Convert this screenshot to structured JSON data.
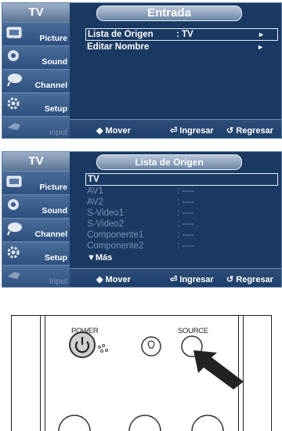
{
  "screen1": {
    "sidebar_title": "TV",
    "header_title": "Entrada",
    "sidebar": [
      {
        "label": "Picture",
        "icon": "picture-icon"
      },
      {
        "label": "Sound",
        "icon": "sound-icon"
      },
      {
        "label": "Channel",
        "icon": "channel-icon"
      },
      {
        "label": "Setup",
        "icon": "setup-icon"
      },
      {
        "label": "Input",
        "icon": "input-icon"
      }
    ],
    "rows": [
      {
        "label": "Lista de Origen",
        "value": ": TV",
        "arrow": "►"
      },
      {
        "label": "Editar Nombre",
        "value": "",
        "arrow": "►"
      }
    ],
    "hints": {
      "move": "◆ Mover",
      "enter": "⏎ Ingresar",
      "return": "↺ Regresar"
    }
  },
  "screen2": {
    "sidebar_title": "TV",
    "header_title": "Lista de Origen",
    "sidebar": [
      {
        "label": "Picture",
        "icon": "picture-icon"
      },
      {
        "label": "Sound",
        "icon": "sound-icon"
      },
      {
        "label": "Channel",
        "icon": "channel-icon"
      },
      {
        "label": "Setup",
        "icon": "setup-icon"
      },
      {
        "label": "Input",
        "icon": "input-icon"
      }
    ],
    "rows": [
      {
        "label": "TV",
        "value": ""
      },
      {
        "label": "AV1",
        "value": ": ----"
      },
      {
        "label": "AV2",
        "value": ": ----"
      },
      {
        "label": "S-Video1",
        "value": ": ----"
      },
      {
        "label": "S-Video2",
        "value": ": ----"
      },
      {
        "label": "Componente1",
        "value": ": ----"
      },
      {
        "label": "Componente2",
        "value": ": ----"
      }
    ],
    "more_label": "▼Más",
    "hints": {
      "move": "◆ Mover",
      "enter": "⏎ Ingresar",
      "return": "↺ Regresar"
    }
  },
  "remote": {
    "power_label": "POWER",
    "source_label": "SOURCE"
  }
}
